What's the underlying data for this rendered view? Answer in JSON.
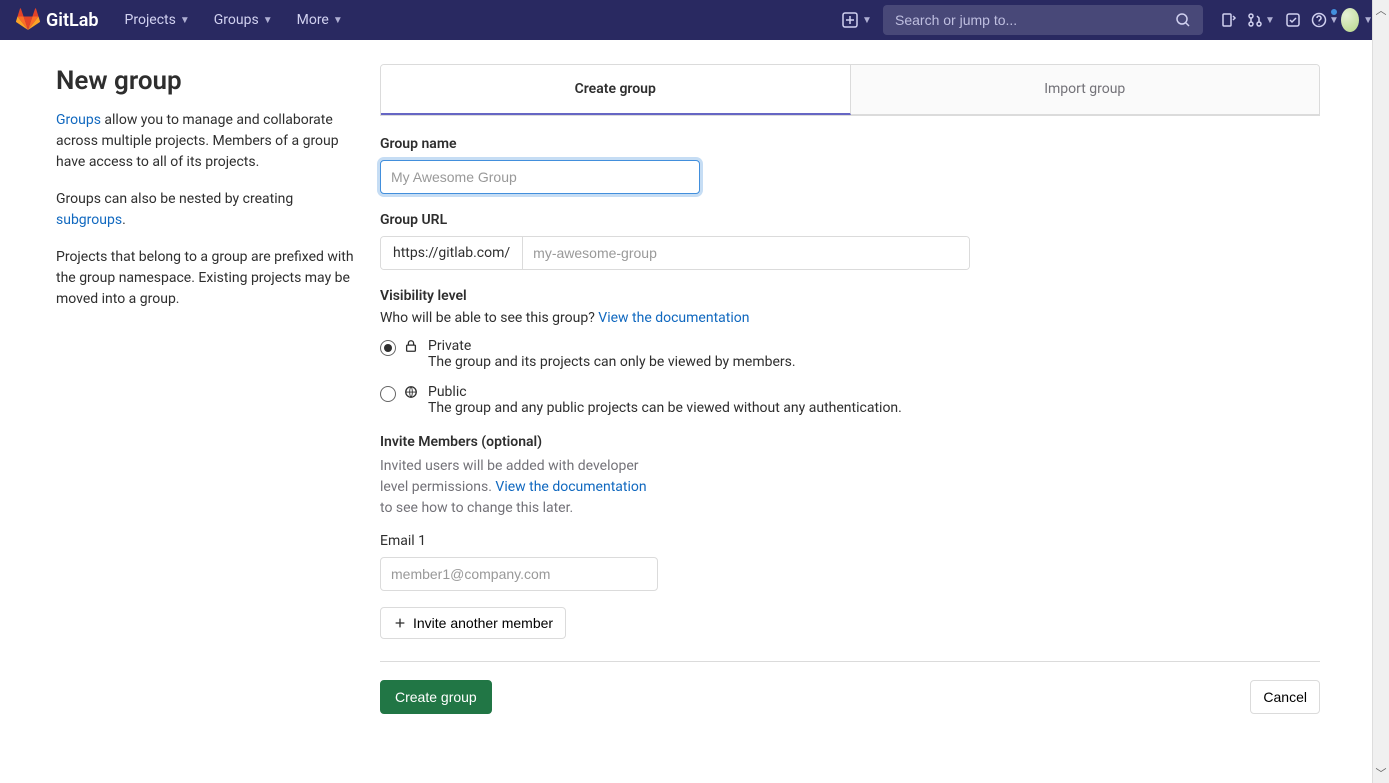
{
  "topbar": {
    "brand": "GitLab",
    "nav": {
      "projects": "Projects",
      "groups": "Groups",
      "more": "More"
    },
    "search_placeholder": "Search or jump to..."
  },
  "sidebar": {
    "title": "New group",
    "para1_link": "Groups",
    "para1_rest": " allow you to manage and collaborate across multiple projects. Members of a group have access to all of its projects.",
    "para2_a": "Groups can also be nested by creating ",
    "para2_link": "subgroups",
    "para2_b": ".",
    "para3": "Projects that belong to a group are prefixed with the group namespace. Existing projects may be moved into a group."
  },
  "tabs": {
    "create": "Create group",
    "import": "Import group"
  },
  "form": {
    "group_name_label": "Group name",
    "group_name_placeholder": "My Awesome Group",
    "group_url_label": "Group URL",
    "url_prefix": "https://gitlab.com/",
    "url_placeholder": "my-awesome-group",
    "visibility_title": "Visibility level",
    "visibility_help_a": "Who will be able to see this group? ",
    "visibility_help_link": "View the documentation",
    "private_label": "Private",
    "private_desc": "The group and its projects can only be viewed by members.",
    "public_label": "Public",
    "public_desc": "The group and any public projects can be viewed without any authentication.",
    "invite_title": "Invite Members (optional)",
    "invite_help_a": "Invited users will be added with developer level permissions. ",
    "invite_help_link": "View the documentation",
    "invite_help_b": " to see how to change this later.",
    "email_label": "Email 1",
    "email_placeholder": "member1@company.com",
    "invite_another": "Invite another member",
    "submit": "Create group",
    "cancel": "Cancel"
  }
}
